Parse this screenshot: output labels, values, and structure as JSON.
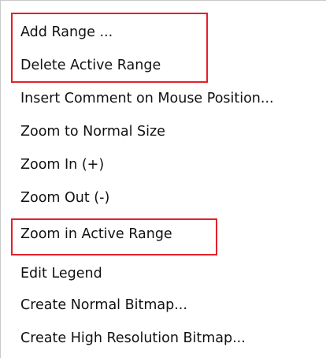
{
  "menu": {
    "items": [
      {
        "label": "Add Range ..."
      },
      {
        "label": "Delete Active Range"
      },
      {
        "label": "Insert Comment on Mouse Position..."
      },
      {
        "label": "Zoom to Normal Size"
      },
      {
        "label": "Zoom In (+)"
      },
      {
        "label": "Zoom Out (-)"
      },
      {
        "label": "Zoom in Active Range"
      },
      {
        "label": "Edit Legend"
      },
      {
        "label": "Create Normal Bitmap..."
      },
      {
        "label": "Create High Resolution Bitmap..."
      }
    ]
  },
  "colors": {
    "highlight": "#e4202a",
    "text": "#111111",
    "background": "#ffffff"
  }
}
